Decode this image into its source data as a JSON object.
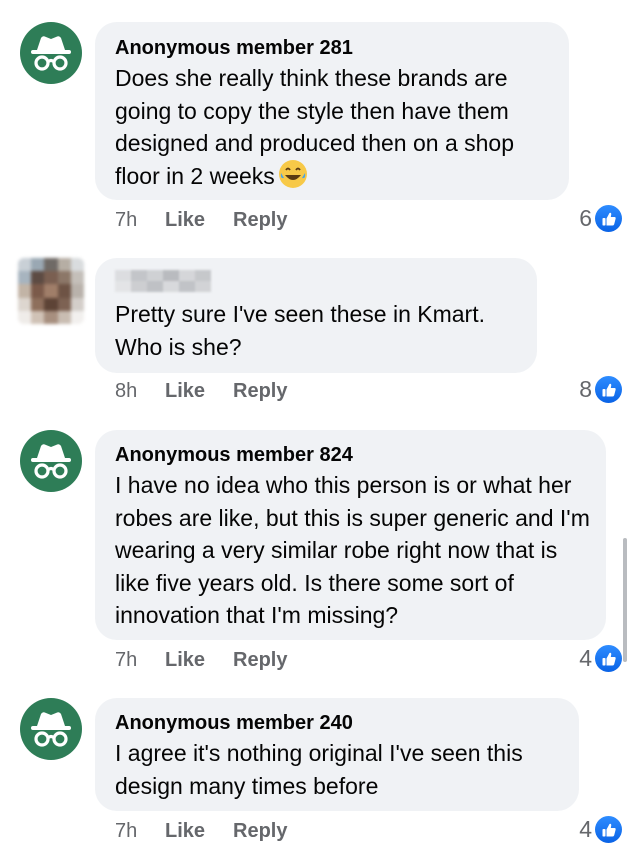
{
  "colors": {
    "avatar_bg": "#2e7d57",
    "bubble_bg": "#f0f2f5",
    "meta_text": "#65676b",
    "like_blue": "#1877f2"
  },
  "comments": [
    {
      "author": "Anonymous member 281",
      "text": "Does she really think these brands are going to copy the style then have them designed and produced then on a shop floor in 2 weeks",
      "emoji": "laughing-tears-emoji",
      "time": "7h",
      "like_label": "Like",
      "reply_label": "Reply",
      "reaction_count": "6",
      "avatar_icon": "incognito-icon"
    },
    {
      "author": "",
      "text": "Pretty sure I've seen these in Kmart. Who is she?",
      "time": "8h",
      "like_label": "Like",
      "reply_label": "Reply",
      "reaction_count": "8",
      "avatar_icon": "pixelated-avatar"
    },
    {
      "author": "Anonymous member 824",
      "text": "I have no idea who this person is or what her robes are like, but this is super generic and I'm wearing a very similar robe right now that is like five years old. Is there some sort of innovation that I'm missing?",
      "time": "7h",
      "like_label": "Like",
      "reply_label": "Reply",
      "reaction_count": "4",
      "avatar_icon": "incognito-icon"
    },
    {
      "author": "Anonymous member 240",
      "text": "I agree it's nothing original I've seen this design many times before",
      "time": "7h",
      "like_label": "Like",
      "reply_label": "Reply",
      "reaction_count": "4",
      "avatar_icon": "incognito-icon"
    }
  ]
}
